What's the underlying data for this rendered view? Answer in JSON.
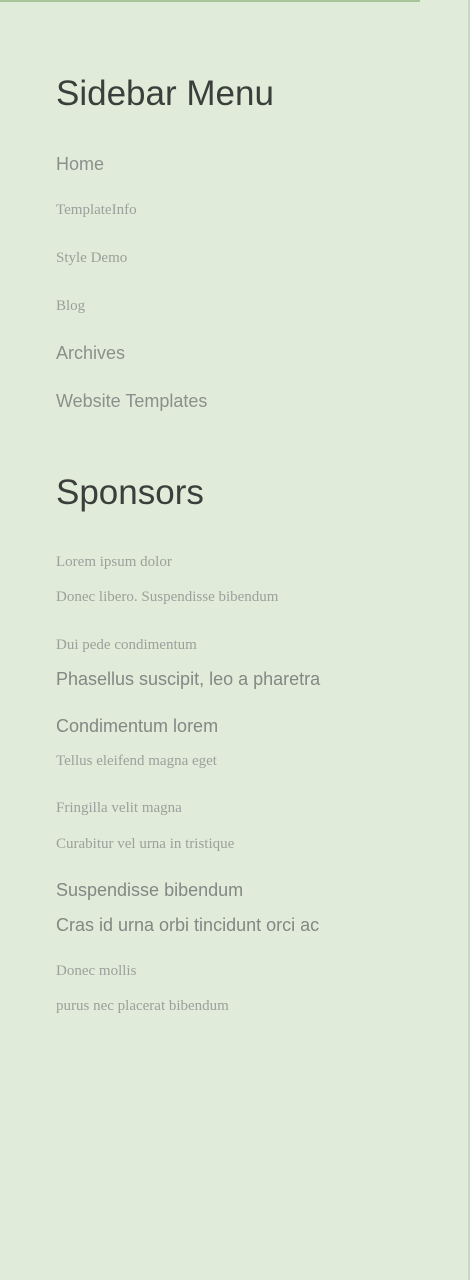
{
  "sidebar_menu": {
    "title": "Sidebar Menu",
    "items": [
      "Home",
      "TemplateInfo",
      "Style Demo",
      "Blog",
      "Archives",
      "Website Templates"
    ]
  },
  "sponsors": {
    "title": "Sponsors",
    "items": [
      "Lorem ipsum dolor",
      "Donec libero. Suspendisse bibendum",
      "Dui pede condimentum",
      "Phasellus suscipit, leo a pharetra",
      "Condimentum lorem",
      "Tellus eleifend magna eget",
      "Fringilla velit magna",
      "Curabitur vel urna in tristique",
      "Suspendisse bibendum",
      "Cras id urna orbi tincidunt orci ac",
      "Donec mollis",
      "purus nec placerat bibendum"
    ]
  }
}
